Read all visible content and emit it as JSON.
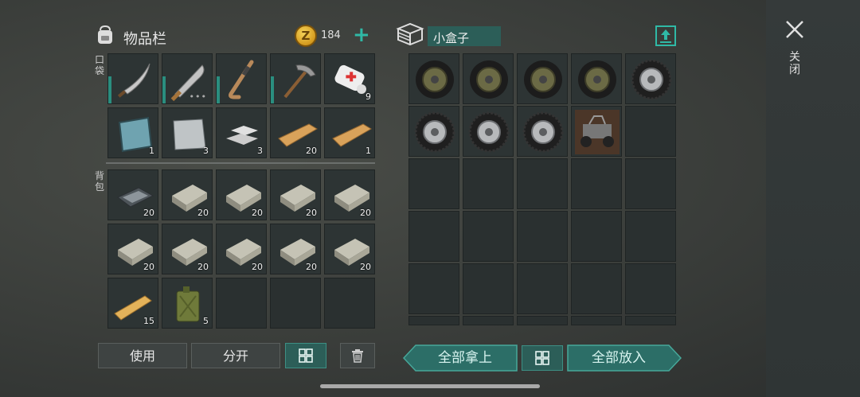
{
  "inventory": {
    "title": "物品栏",
    "coins": "184",
    "coin_symbol": "Z",
    "plus_label": "+",
    "pocket_label": "口袋",
    "backpack_label": "背包",
    "pocket_slots": [
      {
        "icon": "curved-sword-icon",
        "count": "",
        "durability": true
      },
      {
        "icon": "machete-icon",
        "count": "",
        "durability": true,
        "dots": "•••"
      },
      {
        "icon": "hockey-stick-icon",
        "count": "",
        "durability": true
      },
      {
        "icon": "pickaxe-icon",
        "count": "",
        "durability": true
      },
      {
        "icon": "bandage-icon",
        "count": "9"
      },
      {
        "icon": "glass-plate-icon",
        "count": "1"
      },
      {
        "icon": "steel-sheet-icon",
        "count": "3"
      },
      {
        "icon": "metal-ingots-icon",
        "count": "3"
      },
      {
        "icon": "wood-plank-icon",
        "count": "20"
      },
      {
        "icon": "wood-plank-icon",
        "count": "1"
      }
    ],
    "backpack_slots": [
      {
        "icon": "iron-bar-icon",
        "count": "20"
      },
      {
        "icon": "stone-block-icon",
        "count": "20"
      },
      {
        "icon": "stone-block-icon",
        "count": "20"
      },
      {
        "icon": "stone-block-icon",
        "count": "20"
      },
      {
        "icon": "stone-block-icon",
        "count": "20"
      },
      {
        "icon": "stone-block-icon",
        "count": "20"
      },
      {
        "icon": "stone-block-icon",
        "count": "20"
      },
      {
        "icon": "stone-block-icon",
        "count": "20"
      },
      {
        "icon": "stone-block-icon",
        "count": "20"
      },
      {
        "icon": "stone-block-icon",
        "count": "20"
      },
      {
        "icon": "plank-icon",
        "count": "15"
      },
      {
        "icon": "jerrycan-icon",
        "count": "5"
      },
      {
        "icon": "",
        "count": ""
      },
      {
        "icon": "",
        "count": ""
      },
      {
        "icon": "",
        "count": ""
      }
    ],
    "use_label": "使用",
    "split_label": "分开"
  },
  "container": {
    "title": "小盒子",
    "slots": [
      {
        "icon": "wheel-olive-icon"
      },
      {
        "icon": "wheel-olive-icon"
      },
      {
        "icon": "wheel-olive-icon"
      },
      {
        "icon": "wheel-olive-icon"
      },
      {
        "icon": "wheel-silver-icon"
      },
      {
        "icon": "wheel-silver-icon"
      },
      {
        "icon": "wheel-silver-icon"
      },
      {
        "icon": "wheel-silver-icon"
      },
      {
        "icon": "atv-icon"
      },
      {
        "icon": ""
      }
    ],
    "take_all_label": "全部拿上",
    "put_all_label": "全部放入"
  },
  "close_label": "关闭",
  "colors": {
    "accent": "#2fb9a6",
    "teal_button": "#2c5e58"
  }
}
